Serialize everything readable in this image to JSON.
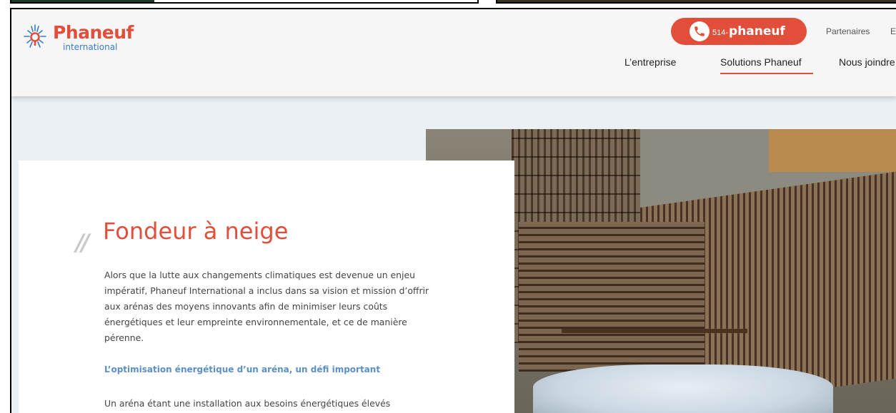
{
  "brand": {
    "name": "Phaneuf",
    "tagline": "international",
    "accent_color": "#e14f3a",
    "secondary_color": "#3a7bc8"
  },
  "header": {
    "phone": {
      "prefix": "514-",
      "name": "phaneuf",
      "icon": "phone-icon"
    },
    "utility_links": [
      "Partenaires",
      "E"
    ],
    "nav": [
      {
        "label": "L’entreprise",
        "active": false
      },
      {
        "label": "Solutions Phaneuf",
        "active": true
      },
      {
        "label": "Nous joindre",
        "active": false
      }
    ]
  },
  "content": {
    "decor": "//",
    "title": "Fondeur à neige",
    "paragraph_1": "Alors que la lutte aux changements climatiques est devenue un enjeu impératif, Phaneuf International a inclus dans sa vision et mission d’offrir aux arénas des moyens innovants afin de minimiser leurs coûts énergétiques et leur empreinte environnementale, et ce de manière pérenne.",
    "subheading": "L’optimisation énergétique d’un aréna, un défi important",
    "paragraph_2": "Un aréna étant une installation aux besoins énergétiques élevés"
  }
}
